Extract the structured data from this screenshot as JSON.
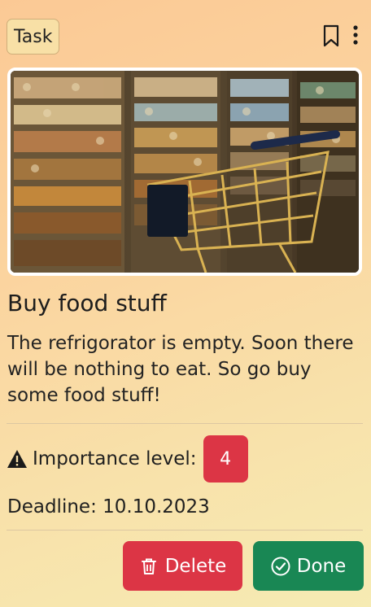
{
  "card": {
    "category_label": "Task",
    "title": "Buy food stuff",
    "description": "The refrigorator is empty. Soon there will be nothing to eat. So go buy some food stuff!",
    "image_alt": "Shopping cart in supermarket aisle",
    "importance": {
      "label": "Importance level:",
      "value": "4"
    },
    "deadline": "Deadline: 10.10.2023",
    "actions": {
      "delete_label": "Delete",
      "done_label": "Done"
    }
  },
  "icons": {
    "bookmark": "bookmark-icon",
    "more": "kebab-menu-icon",
    "warning": "warning-triangle-icon",
    "trash": "trash-icon",
    "check": "check-circle-icon"
  },
  "colors": {
    "danger": "#dc3545",
    "success": "#198754",
    "background_gradient": [
      "#fbc995",
      "#f6ebb3"
    ]
  }
}
